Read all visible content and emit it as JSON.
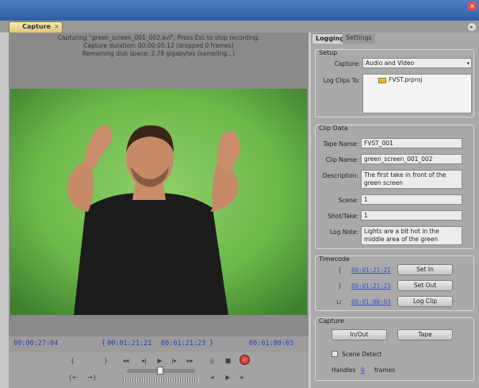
{
  "window": {
    "panel_tab": "Capture",
    "tab_close": "×",
    "close_glyph": "×",
    "menu_glyph": "▸"
  },
  "monitor": {
    "status_lines": [
      "Capturing \"green_screen_001_002.avi\", Press Esc to stop recording.",
      "Capture duration: 00:00:05:12  (dropped 0 frames)",
      "Remaining disk space: 2.78 gigabytes (sampling...)"
    ],
    "current_tc": "00:00:27:04",
    "in_tc": "00:01:21:21",
    "out_tc": "00:01:21:23",
    "duration_tc": "00:01:00:03",
    "bracket_open": "{",
    "bracket_close": "}"
  },
  "transport": {
    "row1": [
      "{",
      "}",
      "◂◂",
      "◂|",
      "▶",
      "|▸",
      "▸▸",
      "||",
      "■"
    ],
    "row2": [
      "{←",
      "→}",
      "◂",
      "▶",
      "▸"
    ]
  },
  "tabs": {
    "logging": "Logging",
    "settings": "Settings"
  },
  "setup": {
    "title": "Setup",
    "capture_label": "Capture:",
    "capture_value": "Audio and Video",
    "log_clips_label": "Log Clips To:",
    "project": "FVST.prproj"
  },
  "clip_data": {
    "title": "Clip Data",
    "tape_name_label": "Tape Name:",
    "tape_name": "FVST_001",
    "clip_name_label": "Clip Name:",
    "clip_name": "green_screen_001_002",
    "description_label": "Description:",
    "description": "The first take in front of the green screen",
    "scene_label": "Scene:",
    "scene": "1",
    "shot_label": "Shot/Take:",
    "shot": "1",
    "log_note_label": "Log Note:",
    "log_note": "Lights are a bit hot in the middle area of the green screen"
  },
  "timecode": {
    "title": "Timecode",
    "in": "00:01:21:21",
    "out": "00:01:21:23",
    "duration": "00:01:00:03",
    "set_in": "Set In",
    "set_out": "Set Out",
    "log_clip": "Log Clip"
  },
  "capture": {
    "title": "Capture",
    "in_out": "In/Out",
    "tape": "Tape",
    "scene_detect": "Scene Detect",
    "handles_label": "Handles",
    "handles_value": "0",
    "handles_unit": "frames"
  }
}
